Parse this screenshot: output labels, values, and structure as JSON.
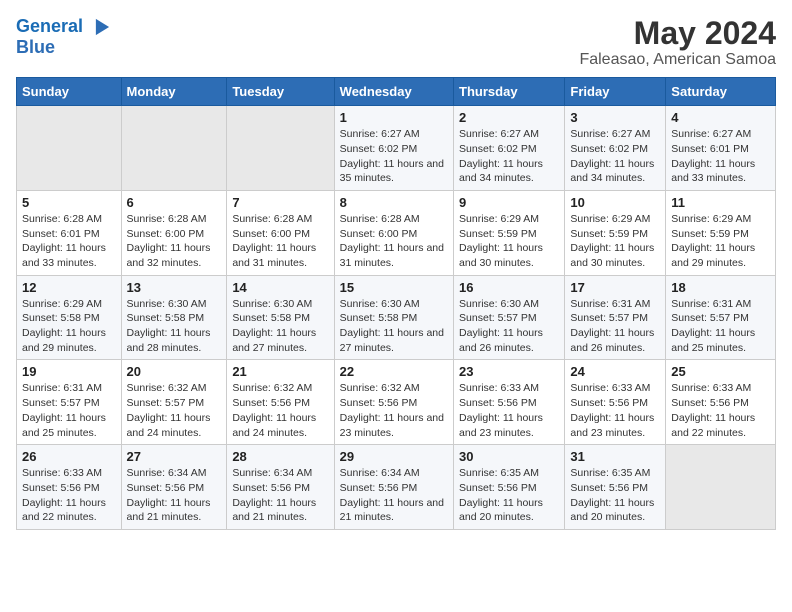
{
  "logo": {
    "line1": "General",
    "line2": "Blue",
    "icon": "▶"
  },
  "title": "May 2024",
  "subtitle": "Faleasao, American Samoa",
  "days_header": [
    "Sunday",
    "Monday",
    "Tuesday",
    "Wednesday",
    "Thursday",
    "Friday",
    "Saturday"
  ],
  "weeks": [
    [
      {
        "day": "",
        "sunrise": "",
        "sunset": "",
        "daylight": ""
      },
      {
        "day": "",
        "sunrise": "",
        "sunset": "",
        "daylight": ""
      },
      {
        "day": "",
        "sunrise": "",
        "sunset": "",
        "daylight": ""
      },
      {
        "day": "1",
        "sunrise": "Sunrise: 6:27 AM",
        "sunset": "Sunset: 6:02 PM",
        "daylight": "Daylight: 11 hours and 35 minutes."
      },
      {
        "day": "2",
        "sunrise": "Sunrise: 6:27 AM",
        "sunset": "Sunset: 6:02 PM",
        "daylight": "Daylight: 11 hours and 34 minutes."
      },
      {
        "day": "3",
        "sunrise": "Sunrise: 6:27 AM",
        "sunset": "Sunset: 6:02 PM",
        "daylight": "Daylight: 11 hours and 34 minutes."
      },
      {
        "day": "4",
        "sunrise": "Sunrise: 6:27 AM",
        "sunset": "Sunset: 6:01 PM",
        "daylight": "Daylight: 11 hours and 33 minutes."
      }
    ],
    [
      {
        "day": "5",
        "sunrise": "Sunrise: 6:28 AM",
        "sunset": "Sunset: 6:01 PM",
        "daylight": "Daylight: 11 hours and 33 minutes."
      },
      {
        "day": "6",
        "sunrise": "Sunrise: 6:28 AM",
        "sunset": "Sunset: 6:00 PM",
        "daylight": "Daylight: 11 hours and 32 minutes."
      },
      {
        "day": "7",
        "sunrise": "Sunrise: 6:28 AM",
        "sunset": "Sunset: 6:00 PM",
        "daylight": "Daylight: 11 hours and 31 minutes."
      },
      {
        "day": "8",
        "sunrise": "Sunrise: 6:28 AM",
        "sunset": "Sunset: 6:00 PM",
        "daylight": "Daylight: 11 hours and 31 minutes."
      },
      {
        "day": "9",
        "sunrise": "Sunrise: 6:29 AM",
        "sunset": "Sunset: 5:59 PM",
        "daylight": "Daylight: 11 hours and 30 minutes."
      },
      {
        "day": "10",
        "sunrise": "Sunrise: 6:29 AM",
        "sunset": "Sunset: 5:59 PM",
        "daylight": "Daylight: 11 hours and 30 minutes."
      },
      {
        "day": "11",
        "sunrise": "Sunrise: 6:29 AM",
        "sunset": "Sunset: 5:59 PM",
        "daylight": "Daylight: 11 hours and 29 minutes."
      }
    ],
    [
      {
        "day": "12",
        "sunrise": "Sunrise: 6:29 AM",
        "sunset": "Sunset: 5:58 PM",
        "daylight": "Daylight: 11 hours and 29 minutes."
      },
      {
        "day": "13",
        "sunrise": "Sunrise: 6:30 AM",
        "sunset": "Sunset: 5:58 PM",
        "daylight": "Daylight: 11 hours and 28 minutes."
      },
      {
        "day": "14",
        "sunrise": "Sunrise: 6:30 AM",
        "sunset": "Sunset: 5:58 PM",
        "daylight": "Daylight: 11 hours and 27 minutes."
      },
      {
        "day": "15",
        "sunrise": "Sunrise: 6:30 AM",
        "sunset": "Sunset: 5:58 PM",
        "daylight": "Daylight: 11 hours and 27 minutes."
      },
      {
        "day": "16",
        "sunrise": "Sunrise: 6:30 AM",
        "sunset": "Sunset: 5:57 PM",
        "daylight": "Daylight: 11 hours and 26 minutes."
      },
      {
        "day": "17",
        "sunrise": "Sunrise: 6:31 AM",
        "sunset": "Sunset: 5:57 PM",
        "daylight": "Daylight: 11 hours and 26 minutes."
      },
      {
        "day": "18",
        "sunrise": "Sunrise: 6:31 AM",
        "sunset": "Sunset: 5:57 PM",
        "daylight": "Daylight: 11 hours and 25 minutes."
      }
    ],
    [
      {
        "day": "19",
        "sunrise": "Sunrise: 6:31 AM",
        "sunset": "Sunset: 5:57 PM",
        "daylight": "Daylight: 11 hours and 25 minutes."
      },
      {
        "day": "20",
        "sunrise": "Sunrise: 6:32 AM",
        "sunset": "Sunset: 5:57 PM",
        "daylight": "Daylight: 11 hours and 24 minutes."
      },
      {
        "day": "21",
        "sunrise": "Sunrise: 6:32 AM",
        "sunset": "Sunset: 5:56 PM",
        "daylight": "Daylight: 11 hours and 24 minutes."
      },
      {
        "day": "22",
        "sunrise": "Sunrise: 6:32 AM",
        "sunset": "Sunset: 5:56 PM",
        "daylight": "Daylight: 11 hours and 23 minutes."
      },
      {
        "day": "23",
        "sunrise": "Sunrise: 6:33 AM",
        "sunset": "Sunset: 5:56 PM",
        "daylight": "Daylight: 11 hours and 23 minutes."
      },
      {
        "day": "24",
        "sunrise": "Sunrise: 6:33 AM",
        "sunset": "Sunset: 5:56 PM",
        "daylight": "Daylight: 11 hours and 23 minutes."
      },
      {
        "day": "25",
        "sunrise": "Sunrise: 6:33 AM",
        "sunset": "Sunset: 5:56 PM",
        "daylight": "Daylight: 11 hours and 22 minutes."
      }
    ],
    [
      {
        "day": "26",
        "sunrise": "Sunrise: 6:33 AM",
        "sunset": "Sunset: 5:56 PM",
        "daylight": "Daylight: 11 hours and 22 minutes."
      },
      {
        "day": "27",
        "sunrise": "Sunrise: 6:34 AM",
        "sunset": "Sunset: 5:56 PM",
        "daylight": "Daylight: 11 hours and 21 minutes."
      },
      {
        "day": "28",
        "sunrise": "Sunrise: 6:34 AM",
        "sunset": "Sunset: 5:56 PM",
        "daylight": "Daylight: 11 hours and 21 minutes."
      },
      {
        "day": "29",
        "sunrise": "Sunrise: 6:34 AM",
        "sunset": "Sunset: 5:56 PM",
        "daylight": "Daylight: 11 hours and 21 minutes."
      },
      {
        "day": "30",
        "sunrise": "Sunrise: 6:35 AM",
        "sunset": "Sunset: 5:56 PM",
        "daylight": "Daylight: 11 hours and 20 minutes."
      },
      {
        "day": "31",
        "sunrise": "Sunrise: 6:35 AM",
        "sunset": "Sunset: 5:56 PM",
        "daylight": "Daylight: 11 hours and 20 minutes."
      },
      {
        "day": "",
        "sunrise": "",
        "sunset": "",
        "daylight": ""
      }
    ]
  ]
}
